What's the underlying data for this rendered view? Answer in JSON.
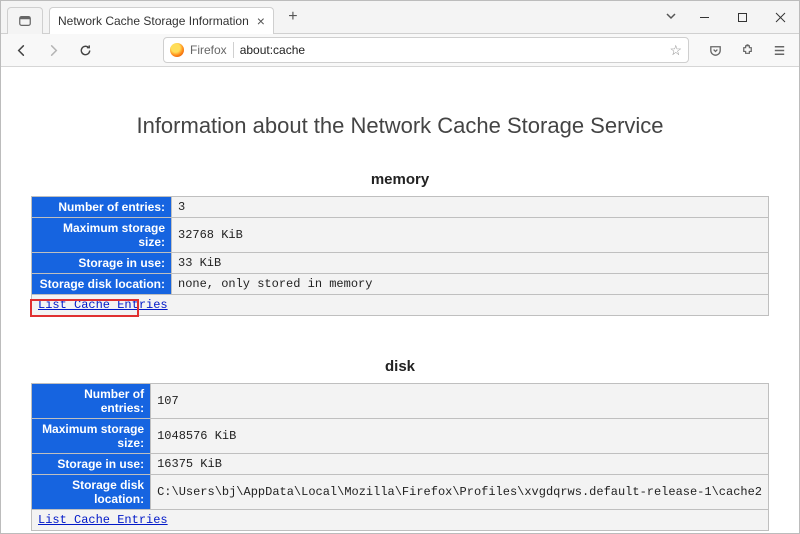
{
  "window": {
    "tab_title": "Network Cache Storage Information"
  },
  "toolbar": {
    "url_label": "Firefox",
    "url_text": "about:cache"
  },
  "page": {
    "title": "Information about the Network Cache Storage Service"
  },
  "sections": {
    "memory": {
      "heading": "memory",
      "labels": {
        "entries": "Number of entries:",
        "max": "Maximum storage size:",
        "inuse": "Storage in use:",
        "loc": "Storage disk location:"
      },
      "values": {
        "entries": "3",
        "max": "32768 KiB",
        "inuse": "33 KiB",
        "loc": "none, only stored in memory"
      },
      "link_text": "List Cache Entries"
    },
    "disk": {
      "heading": "disk",
      "labels": {
        "entries": "Number of entries:",
        "max": "Maximum storage size:",
        "inuse": "Storage in use:",
        "loc": "Storage disk location:"
      },
      "values": {
        "entries": "107",
        "max": "1048576 KiB",
        "inuse": "16375 KiB",
        "loc": "C:\\Users\\bj\\AppData\\Local\\Mozilla\\Firefox\\Profiles\\xvgdqrws.default-release-1\\cache2"
      },
      "link_text": "List Cache Entries"
    }
  }
}
